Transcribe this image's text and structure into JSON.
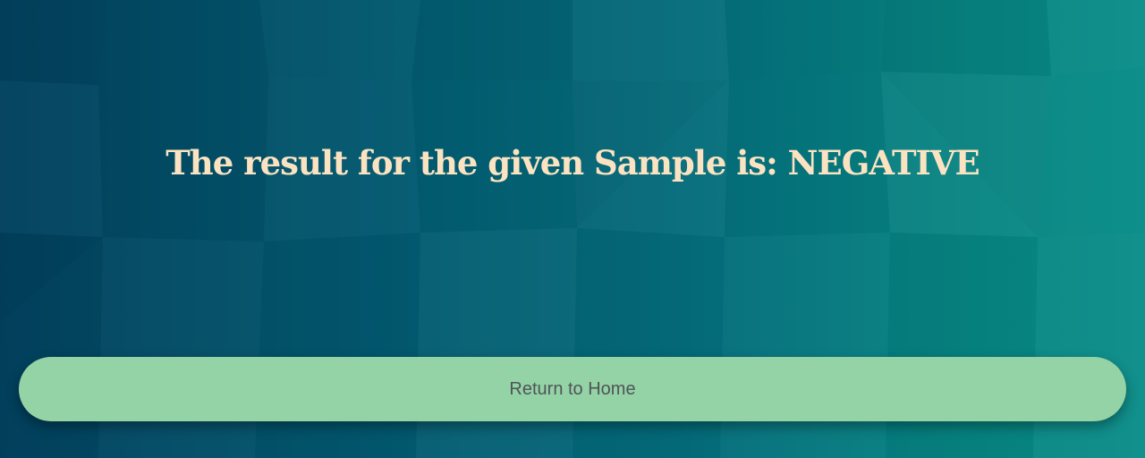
{
  "result": {
    "heading": "The result for the given Sample is: NEGATIVE"
  },
  "actions": {
    "home_label": "Return to Home"
  },
  "colors": {
    "heading_text": "#fbe3c2",
    "button_bg": "#94d3a6",
    "button_text": "#505457",
    "bg_left": "#03425f",
    "bg_right": "#0a8d89"
  }
}
